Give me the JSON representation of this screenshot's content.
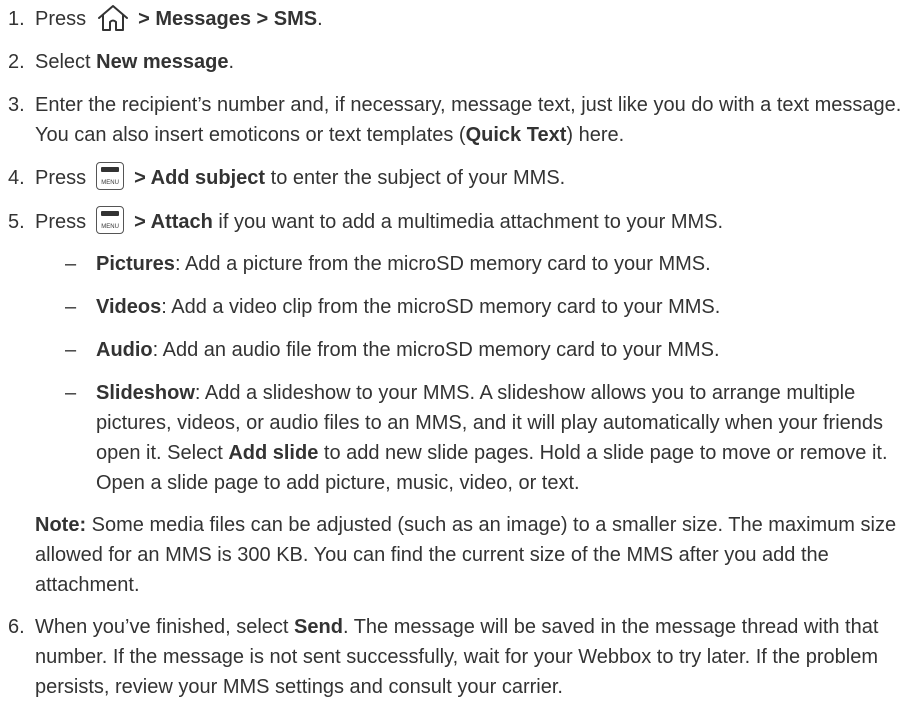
{
  "steps": [
    {
      "num": "1.",
      "t1": "Press",
      "b1": "> Messages > SMS",
      "t2": "."
    },
    {
      "num": "2.",
      "t1": "Select ",
      "b1": "New message",
      "t2": "."
    },
    {
      "num": "3.",
      "t1": "Enter the recipient’s number and, if necessary, message text, just like you do with a text message. You can also insert emoticons or text templates (",
      "b1": "Quick Text",
      "t2": ") here."
    },
    {
      "num": "4.",
      "t1": "Press",
      "b1": "> Add subject",
      "t2": " to enter the subject of your MMS."
    },
    {
      "num": "5.",
      "t1": "Press",
      "b1": "> Attach",
      "t2": " if you want to add a multimedia attachment to your MMS."
    },
    {
      "num": "6.",
      "t1": "When you’ve finished, select ",
      "b1": "Send",
      "t2": ". The message will be saved in the message thread with that number. If the message is not sent successfully, wait for your Webbox to try later. If the problem persists, review your MMS settings and consult your carrier."
    }
  ],
  "attach_options": [
    {
      "dash": "–",
      "title": "Pictures",
      "desc": ": Add a picture from the microSD memory card to your MMS."
    },
    {
      "dash": "–",
      "title": "Videos",
      "desc": ": Add a video clip from the microSD memory card to your MMS."
    },
    {
      "dash": "–",
      "title": "Audio",
      "desc": ": Add an audio file from the microSD memory card to your MMS."
    },
    {
      "dash": "–",
      "title": "Slideshow",
      "desc": ": Add a slideshow to your MMS. A slideshow allows you to arrange multiple pictures, videos, or audio files to an MMS, and it will play automatically when your friends open it. Select ",
      "b2": "Add slide",
      "desc2": " to add new slide pages. Hold a slide page to move or remove it. Open a slide page to add picture, music, video, or text."
    }
  ],
  "note": {
    "label": "Note:",
    "text": " Some media files can be adjusted (such as an image) to a smaller size. The maximum size allowed for an MMS is 300 KB. You can find the current size of the MMS after you add the attachment."
  },
  "icons": {
    "home": "home-icon",
    "menu": "menu-key-icon",
    "menu_label": "MENU"
  }
}
